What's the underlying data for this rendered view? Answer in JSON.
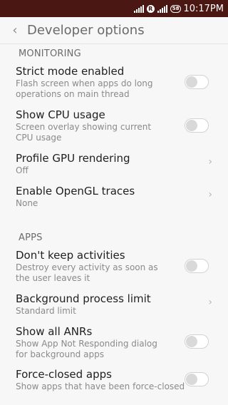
{
  "status_bar": {
    "r_badge": "R",
    "battery": "58",
    "time": "10:17PM"
  },
  "header": {
    "title": "Developer options"
  },
  "sections": {
    "monitoring": "MONITORING",
    "apps": "APPS"
  },
  "items": [
    {
      "title": "Strict mode enabled",
      "summary": "Flash screen when apps do long operations on main thread",
      "control": "toggle",
      "on": false
    },
    {
      "title": "Show CPU usage",
      "summary": "Screen overlay showing current CPU usage",
      "control": "toggle",
      "on": false
    },
    {
      "title": "Profile GPU rendering",
      "summary": "Off",
      "control": "chevron"
    },
    {
      "title": "Enable OpenGL traces",
      "summary": "None",
      "control": "chevron"
    },
    {
      "title": "Don't keep activities",
      "summary": "Destroy every activity as soon as the user leaves it",
      "control": "toggle",
      "on": false
    },
    {
      "title": "Background process limit",
      "summary": "Standard limit",
      "control": "chevron"
    },
    {
      "title": "Show all ANRs",
      "summary": "Show App Not Responding dialog for background apps",
      "control": "toggle",
      "on": false
    },
    {
      "title": "Force-closed apps",
      "summary": "Show apps that have been force-closed",
      "control": "toggle",
      "on": false
    }
  ]
}
